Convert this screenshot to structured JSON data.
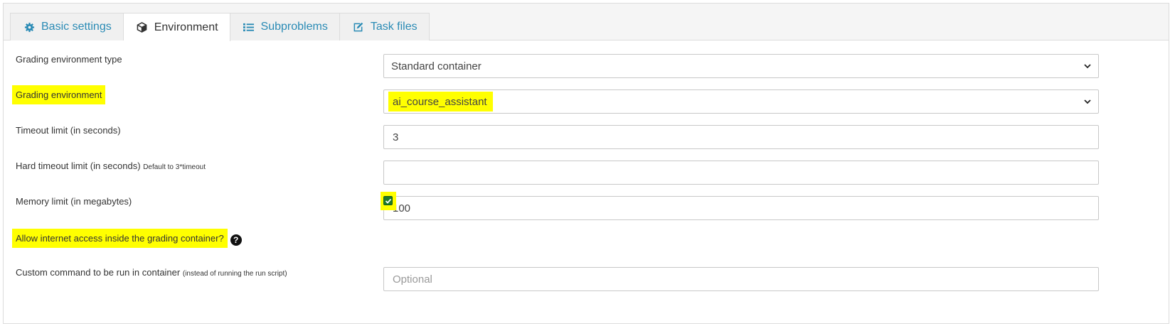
{
  "tabs": [
    {
      "label": "Basic settings",
      "icon": "gear-icon"
    },
    {
      "label": "Environment",
      "icon": "cube-icon"
    },
    {
      "label": "Subproblems",
      "icon": "list-icon"
    },
    {
      "label": "Task files",
      "icon": "edit-icon"
    }
  ],
  "active_tab": "Environment",
  "colors": {
    "link": "#2a8bb5",
    "highlight": "#ffff00",
    "checkbox": "#1e7a2a"
  },
  "form": {
    "env_type": {
      "label": "Grading environment type",
      "value": "Standard container"
    },
    "env": {
      "label": "Grading environment",
      "value": "ai_course_assistant"
    },
    "timeout": {
      "label": "Timeout limit (in seconds)",
      "value": "3"
    },
    "hard_timeout": {
      "label": "Hard timeout limit (in seconds)",
      "hint": "Default to 3*timeout",
      "value": ""
    },
    "memory": {
      "label": "Memory limit (in megabytes)",
      "value": "100"
    },
    "internet": {
      "label": "Allow internet access inside the grading container?",
      "help": "?",
      "checked": true
    },
    "custom_cmd": {
      "label": "Custom command to be run in container",
      "hint": "(instead of running the run script)",
      "value": "",
      "placeholder": "Optional"
    }
  }
}
